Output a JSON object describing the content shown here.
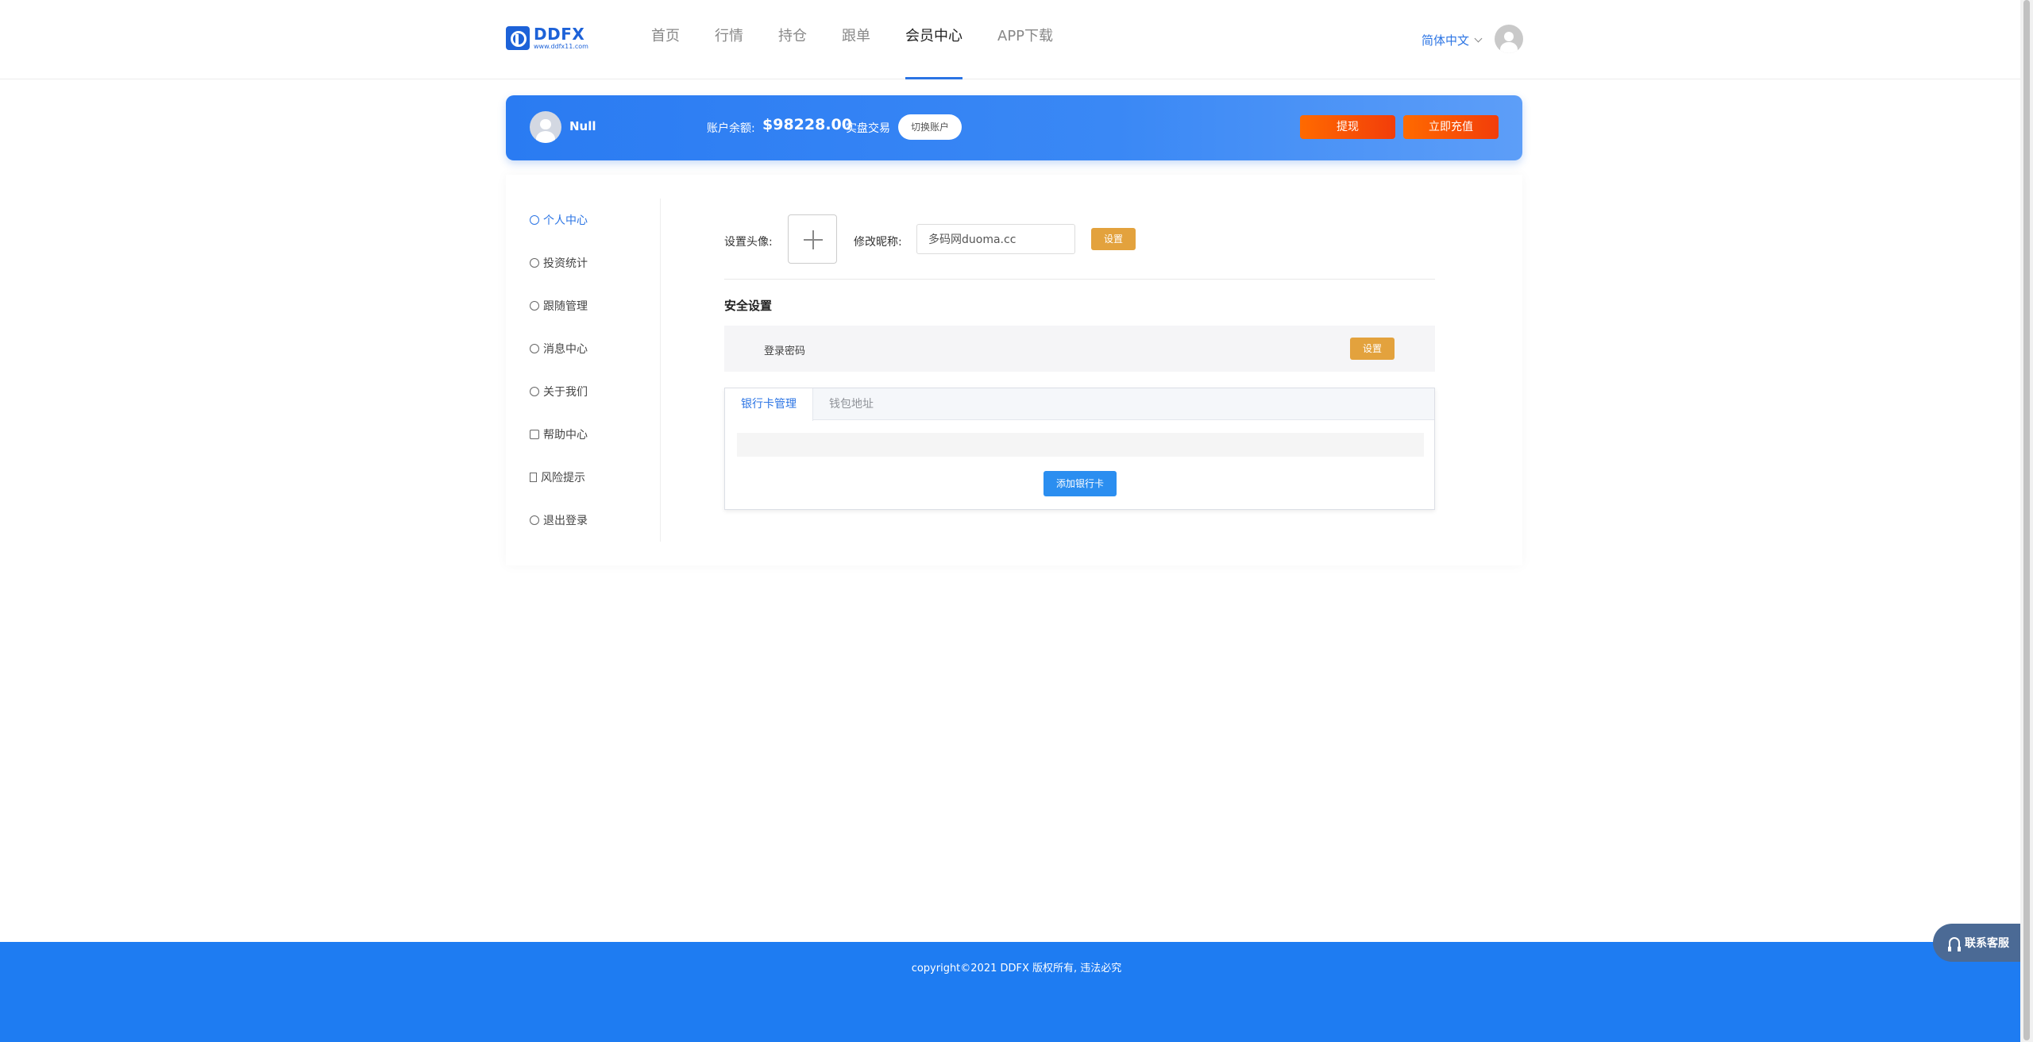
{
  "header": {
    "logo": {
      "name": "DDFX",
      "url": "www.ddfx11.com"
    },
    "nav": [
      {
        "label": "首页"
      },
      {
        "label": "行情"
      },
      {
        "label": "持仓"
      },
      {
        "label": "跟单"
      },
      {
        "label": "会员中心",
        "active": true
      },
      {
        "label": "APP下载"
      }
    ],
    "language": "简体中文",
    "active_color": "#2b74e4"
  },
  "banner": {
    "username": "Null",
    "balance_label": "账户余额:",
    "balance_value": "$98228.00",
    "mode_label": "实盘交易",
    "switch_label": "切换账户",
    "withdraw_label": "提现",
    "recharge_label": "立即充值",
    "gradient": [
      "#2a7bf2",
      "#5d9ef8"
    ]
  },
  "sidebar": {
    "items": [
      {
        "label": "个人中心",
        "icon": "gear-icon",
        "active": true
      },
      {
        "label": "投资统计",
        "icon": "pie-chart-icon"
      },
      {
        "label": "跟随管理",
        "icon": "link-icon"
      },
      {
        "label": "消息中心",
        "icon": "chat-icon"
      },
      {
        "label": "关于我们",
        "icon": "user-icon"
      },
      {
        "label": "帮助中心",
        "icon": "document-icon"
      },
      {
        "label": "风险提示",
        "icon": "bookmark-icon"
      },
      {
        "label": "退出登录",
        "icon": "refresh-icon"
      }
    ]
  },
  "profile": {
    "avatar_label": "设置头像:",
    "nickname_label": "修改昵称:",
    "nickname_value": "多码网duoma.cc",
    "nickname_set_label": "设置"
  },
  "security": {
    "title": "安全设置",
    "login_password_label": "登录密码",
    "set_label": "设置"
  },
  "tabs": {
    "items": [
      {
        "label": "银行卡管理",
        "active": true
      },
      {
        "label": "钱包地址"
      }
    ],
    "add_card_label": "添加银行卡"
  },
  "footer": {
    "copyright": "copyright©2021 DDFX 版权所有, 违法必究"
  },
  "support": {
    "label": "联系客服"
  },
  "colors": {
    "accent": "#2b74e4",
    "orange": "#f23d0a",
    "gold": "#e3a23d",
    "footer": "#1e7cf2"
  }
}
